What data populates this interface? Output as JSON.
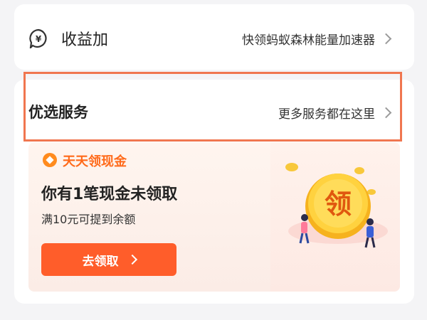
{
  "income": {
    "title": "收益加",
    "link": "快领蚂蚁森林能量加速器"
  },
  "services": {
    "title": "优选服务",
    "link": "更多服务都在这里"
  },
  "promo": {
    "brand": "天天领现金",
    "headline": "你有1笔现金未领取",
    "subtitle": "满10元可提到余额",
    "button": "去领取",
    "coin_glyph": "领"
  },
  "colors": {
    "accent": "#ff5d2a",
    "brand_orange": "#ff6a1a",
    "highlight": "#f0764f"
  }
}
